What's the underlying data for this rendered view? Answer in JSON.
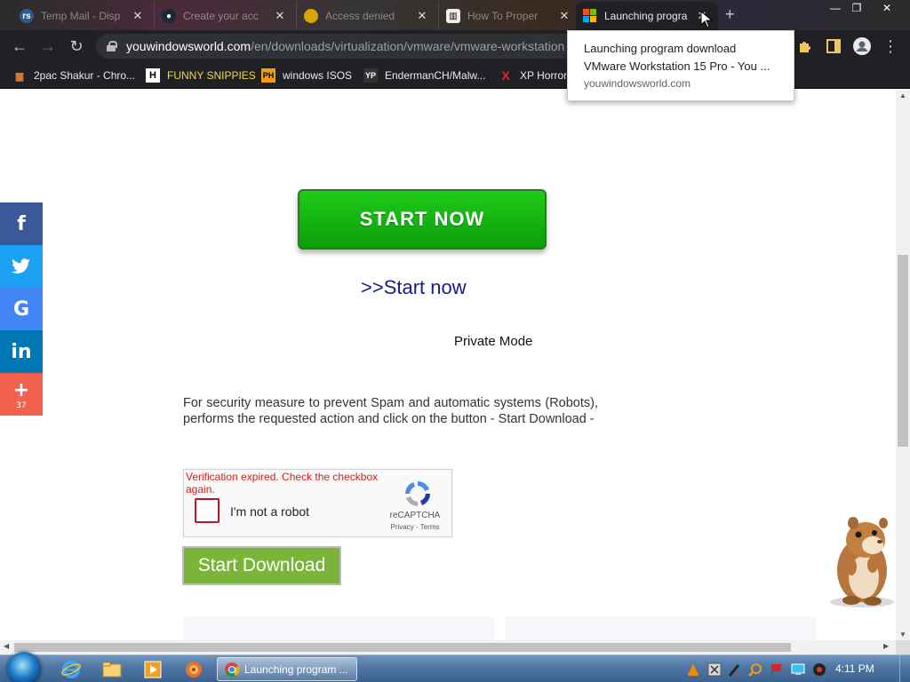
{
  "browser": {
    "tabs": [
      {
        "title": "Temp Mail - Disp",
        "icon": "temp-mail-icon"
      },
      {
        "title": "Create your acc",
        "icon": "steam-icon"
      },
      {
        "title": "Access denied",
        "icon": "chrome-icon"
      },
      {
        "title": "How To Proper",
        "icon": "bookmark-icon"
      },
      {
        "title": "Launching progra",
        "icon": "windows-logo-icon",
        "active": true
      }
    ],
    "url_host": "youwindowsworld.com",
    "url_path": "/en/downloads/virtualization/vmware/vmware-workstation",
    "bookmarks": [
      {
        "label": "2pac Shakur - Chro...",
        "icon": "bookmark-folder-icon"
      },
      {
        "label": "FUNNY SNIPPIES",
        "icon": "h-logo-icon"
      },
      {
        "label": "windows ISOS",
        "icon": "ph-logo-icon"
      },
      {
        "label": "EndermanCH/Malw...",
        "icon": "yp-logo-icon"
      },
      {
        "label": "XP Horror",
        "icon": "x-logo-icon"
      }
    ],
    "tooltip": {
      "line1": "Launching program download",
      "line2": "VMware Workstation 15 Pro - You ...",
      "line3": "youwindowsworld.com"
    }
  },
  "page": {
    "start_now_button": "START NOW",
    "start_now_link": ">>Start now",
    "private_mode": "Private Mode",
    "security_text": "For security measure to prevent Spam and automatic systems (Robots), performs the requested action and click on the button - Start Download -",
    "recaptcha": {
      "error": "Verification expired. Check the checkbox again.",
      "label": "I'm not a robot",
      "brand": "reCAPTCHA",
      "links": "Privacy - Terms"
    },
    "start_download_button": "Start Download",
    "share": {
      "items": [
        {
          "glyph": "f",
          "color": "#3b5998",
          "icon": "facebook-icon"
        },
        {
          "glyph": "🐦",
          "color": "#1da1f2",
          "icon": "twitter-icon"
        },
        {
          "glyph": "G",
          "color": "#4285f4",
          "icon": "google-icon"
        },
        {
          "glyph": "in",
          "color": "#0077b5",
          "icon": "linkedin-icon"
        },
        {
          "glyph": "+",
          "color": "#f0624d",
          "icon": "plus-icon"
        }
      ],
      "count": "37"
    }
  },
  "taskbar": {
    "chrome_label": "Launching program ...",
    "clock": "4:11 PM"
  },
  "colors": {
    "start_now_green": "#10b30e",
    "start_download_green": "#7ab539",
    "link_blue": "#1a1a8a",
    "error_red": "#d0211c"
  }
}
